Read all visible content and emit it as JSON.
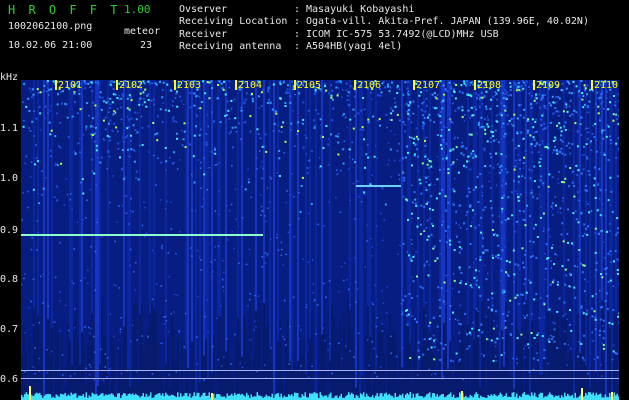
{
  "header": {
    "brand": "H R O F F T",
    "version": "1.00",
    "filename": "1002062100.png",
    "datetime": "10.02.06 21:00",
    "meteor_label": "meteor",
    "meteor_count": "23"
  },
  "info": {
    "rows": [
      {
        "key": "Ovserver",
        "sep": ":",
        "value": "Masayuki Kobayashi"
      },
      {
        "key": "Receiving Location",
        "sep": ":",
        "value": "Ogata-vill. Akita-Pref. JAPAN (139.96E, 40.02N)"
      },
      {
        "key": "Receiver",
        "sep": ":",
        "value": "ICOM IC-575 53.7492(@LCD)MHz USB"
      },
      {
        "key": "Receiving antenna",
        "sep": ":",
        "value": "A504HB(yagi 4el)"
      }
    ]
  },
  "axis": {
    "y_unit": "kHz",
    "y_labels": [
      "1.1",
      "1.0",
      "0.9",
      "0.8",
      "0.7",
      "0.6"
    ],
    "x_labels": [
      "2101",
      "2102",
      "2103",
      "2104",
      "2105",
      "2106",
      "2107",
      "2108",
      "2109",
      "2110"
    ]
  },
  "colors": {
    "background": "#000000",
    "text": "#e8e8e8",
    "brand": "#2bd12b",
    "time_label": "#ffff00",
    "spectrum_low": "#0a1a8a",
    "spectrum_high": "#3ff0ff"
  }
}
